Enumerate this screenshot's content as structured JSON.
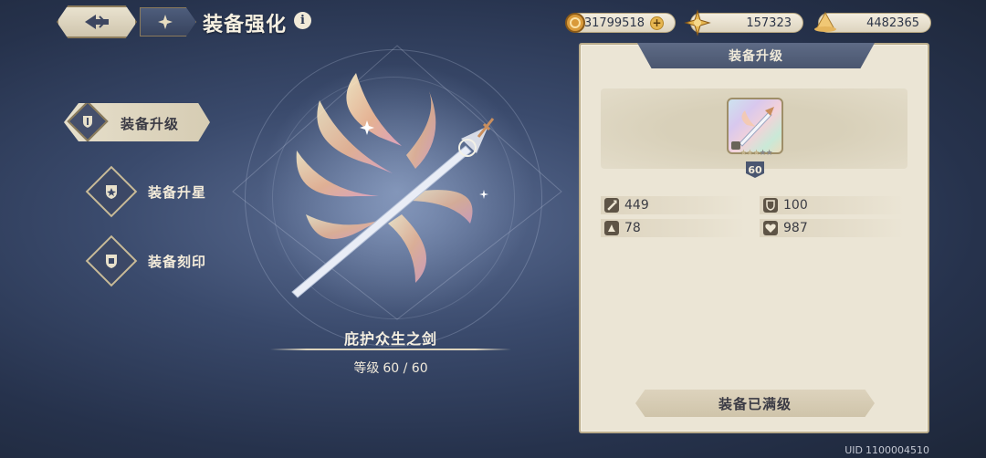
{
  "header": {
    "title": "装备强化"
  },
  "currencies": [
    {
      "name": "gold",
      "value": "31799518",
      "has_plus": true,
      "icon": "coin-icon"
    },
    {
      "name": "star-essence",
      "value": "157323",
      "icon": "star-orb-icon"
    },
    {
      "name": "material",
      "value": "4482365",
      "icon": "hat-material-icon"
    }
  ],
  "nav": {
    "items": [
      {
        "label": "装备升级",
        "active": true,
        "icon": "sword-shield-icon"
      },
      {
        "label": "装备升星",
        "active": false,
        "icon": "star-shield-icon"
      },
      {
        "label": "装备刻印",
        "active": false,
        "icon": "engrave-shield-icon"
      }
    ]
  },
  "weapon": {
    "name": "庇护众生之剑",
    "level_label": "等级",
    "level_value": "60 / 60"
  },
  "panel": {
    "tab_title": "装备升级",
    "item": {
      "level": "60",
      "stars_filled": 3,
      "stars_total": 5,
      "locked": true
    },
    "stats": [
      {
        "icon": "attack-icon",
        "value": "449"
      },
      {
        "icon": "defense-icon",
        "value": "100"
      },
      {
        "icon": "magic-hat-icon",
        "value": "78"
      },
      {
        "icon": "health-icon",
        "value": "987"
      }
    ],
    "max_button_label": "装备已满级"
  },
  "footer": {
    "uid_label": "UID",
    "uid_value": "1100004510"
  },
  "colors": {
    "background": "#2e3a56",
    "panel": "#ebe5d5",
    "accent_gold": "#e6b650",
    "nav_active": "#e6dfcb"
  }
}
